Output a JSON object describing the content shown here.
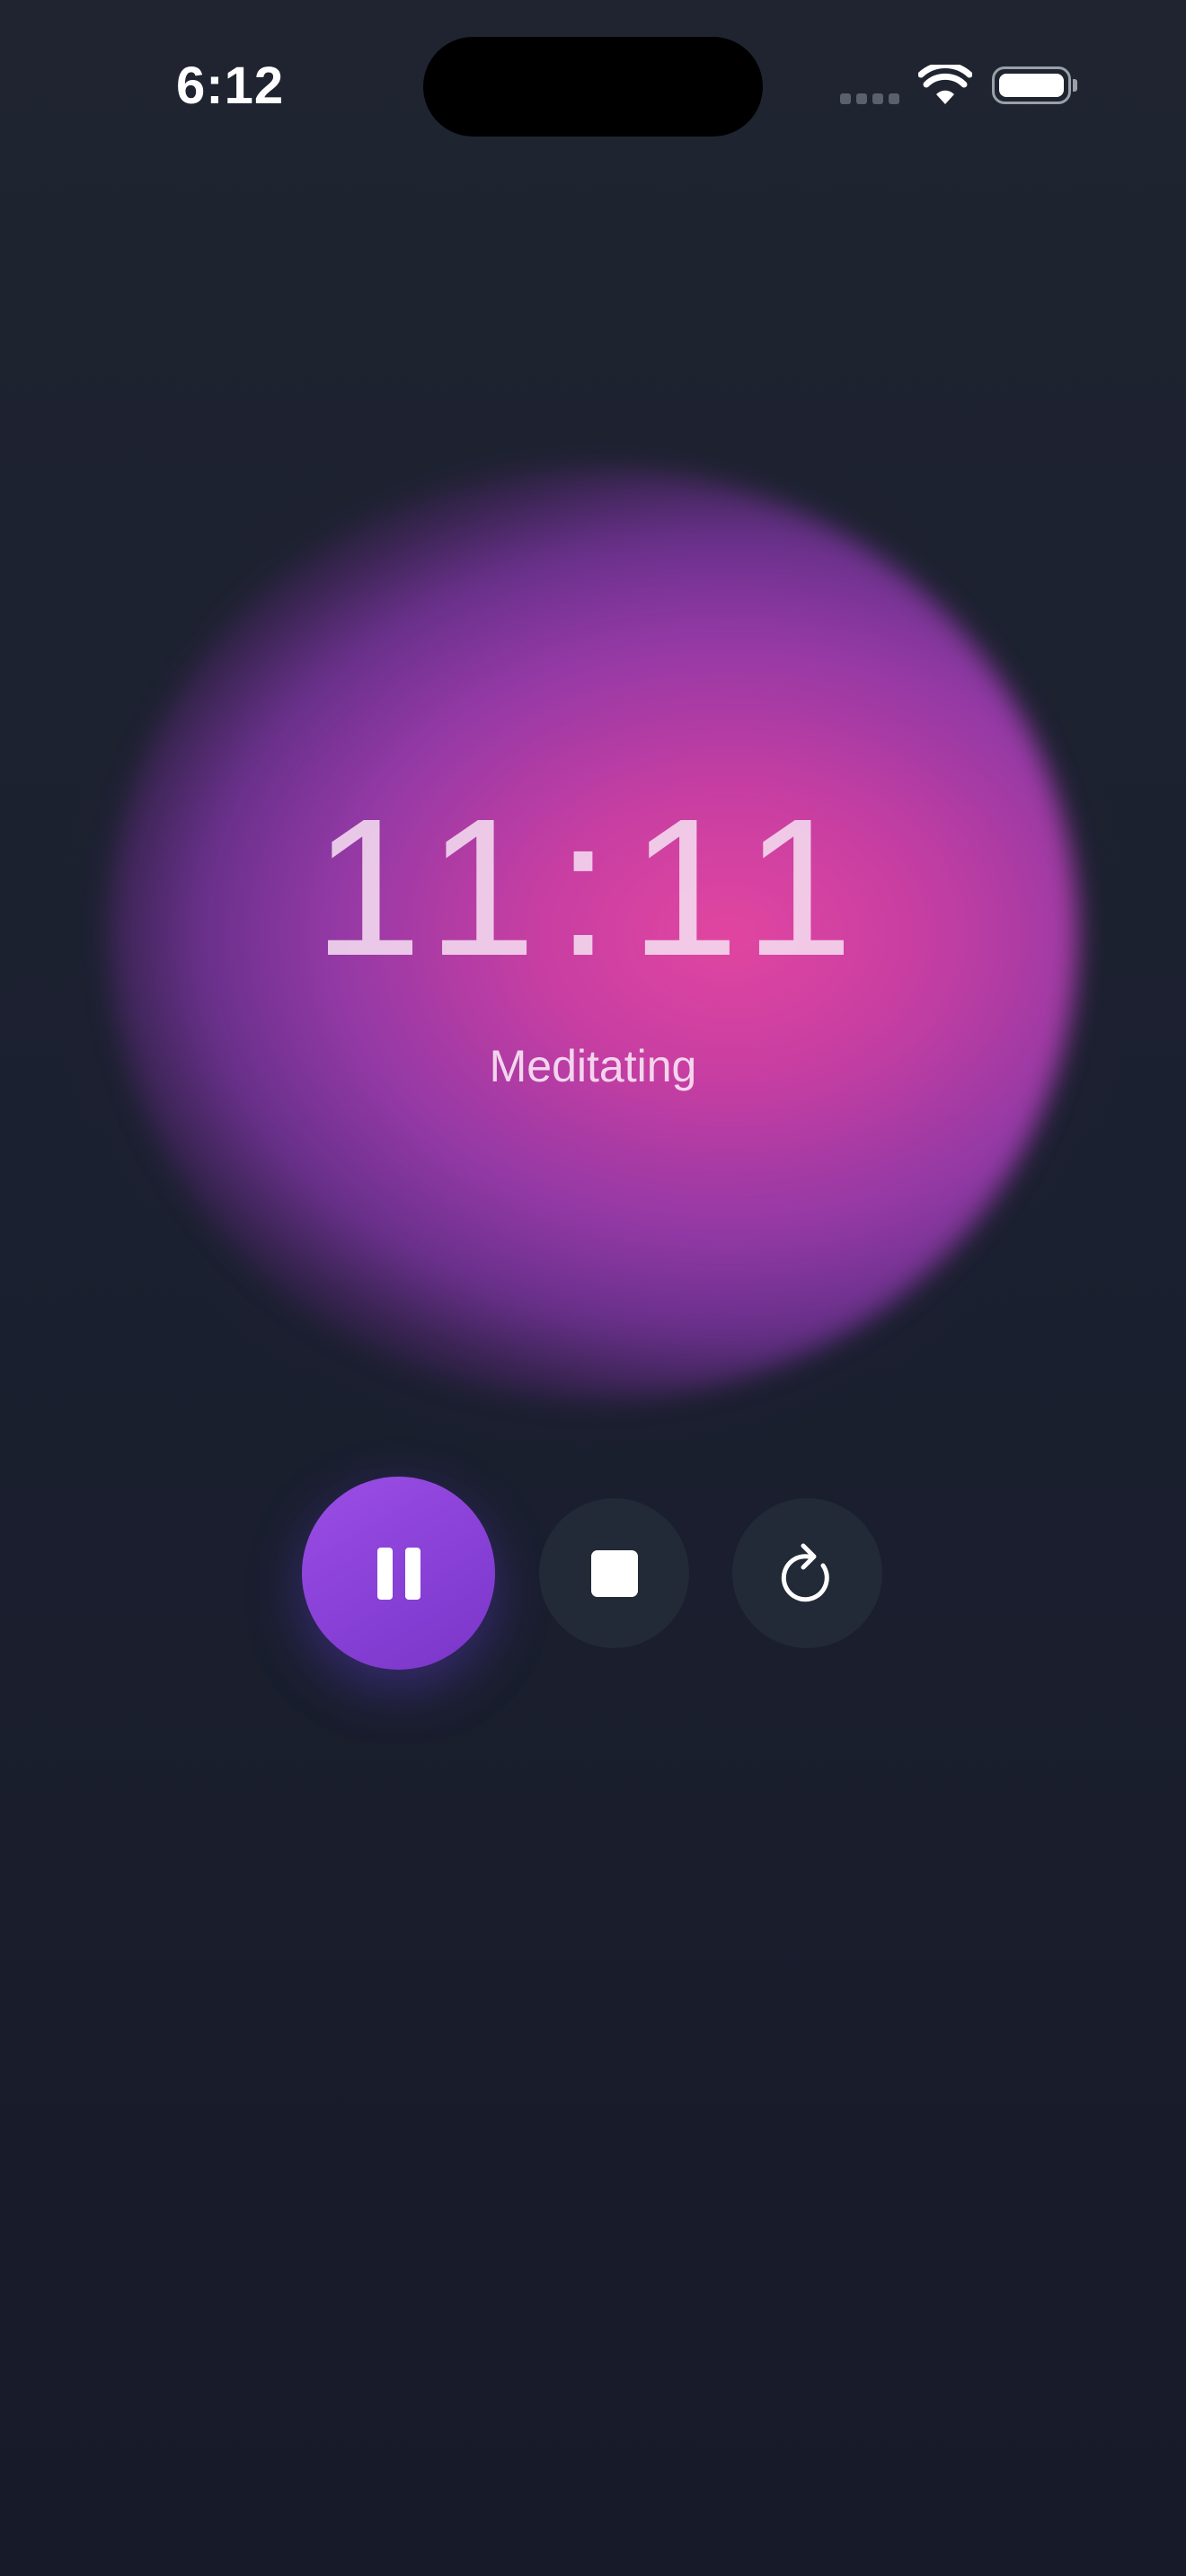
{
  "status_bar": {
    "time": "6:12"
  },
  "timer": {
    "display": "11:11",
    "state_label": "Meditating"
  },
  "controls": {
    "pause_icon": "pause-icon",
    "stop_icon": "stop-icon",
    "restart_icon": "restart-icon"
  },
  "colors": {
    "background": "#1c2130",
    "accent": "#8a42d8",
    "orb_center": "#e246a0",
    "orb_edge": "#8236a8",
    "secondary_button": "#222a37"
  }
}
